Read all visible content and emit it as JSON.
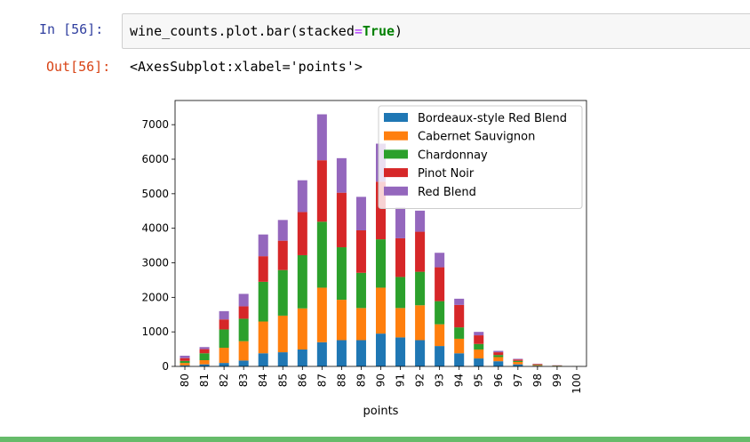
{
  "cell": {
    "in_prompt": "In  [56]:",
    "code_prefix": "wine_counts.plot.bar(stacked",
    "code_eq": "=",
    "code_kw": "True",
    "code_suffix": ")",
    "out_prompt": "Out[56]:",
    "output_text": "<AxesSubplot:xlabel='points'>"
  },
  "chart_data": {
    "type": "bar",
    "stacked": true,
    "xlabel": "points",
    "ylabel": "",
    "ylim": [
      0,
      7700
    ],
    "yticks": [
      0,
      1000,
      2000,
      3000,
      4000,
      5000,
      6000,
      7000
    ],
    "categories": [
      "80",
      "81",
      "82",
      "83",
      "84",
      "85",
      "86",
      "87",
      "88",
      "89",
      "90",
      "91",
      "92",
      "93",
      "94",
      "95",
      "96",
      "97",
      "98",
      "99",
      "100"
    ],
    "legend_position": "upper-right",
    "series": [
      {
        "name": "Bordeaux-style Red Blend",
        "color": "#1f77b4",
        "values": [
          30,
          60,
          100,
          170,
          380,
          410,
          490,
          700,
          760,
          760,
          950,
          840,
          760,
          590,
          380,
          230,
          150,
          60,
          20,
          10,
          2
        ]
      },
      {
        "name": "Cabernet Sauvignon",
        "color": "#ff7f0e",
        "values": [
          70,
          120,
          440,
          560,
          920,
          1060,
          1190,
          1580,
          1170,
          930,
          1330,
          850,
          1010,
          630,
          420,
          260,
          120,
          70,
          20,
          10,
          2
        ]
      },
      {
        "name": "Chardonnay",
        "color": "#2ca02c",
        "values": [
          60,
          200,
          530,
          650,
          1150,
          1320,
          1540,
          1910,
          1520,
          1020,
          1400,
          900,
          970,
          670,
          330,
          160,
          60,
          30,
          10,
          5,
          1
        ]
      },
      {
        "name": "Pinot Noir",
        "color": "#d62728",
        "values": [
          80,
          120,
          290,
          360,
          740,
          850,
          1250,
          1780,
          1580,
          1230,
          1670,
          1120,
          1160,
          980,
          650,
          250,
          80,
          40,
          15,
          5,
          1
        ]
      },
      {
        "name": "Red Blend",
        "color": "#9467bd",
        "values": [
          70,
          60,
          240,
          360,
          630,
          600,
          920,
          1330,
          1000,
          970,
          1100,
          890,
          610,
          420,
          180,
          100,
          40,
          20,
          10,
          5,
          1
        ]
      }
    ]
  }
}
